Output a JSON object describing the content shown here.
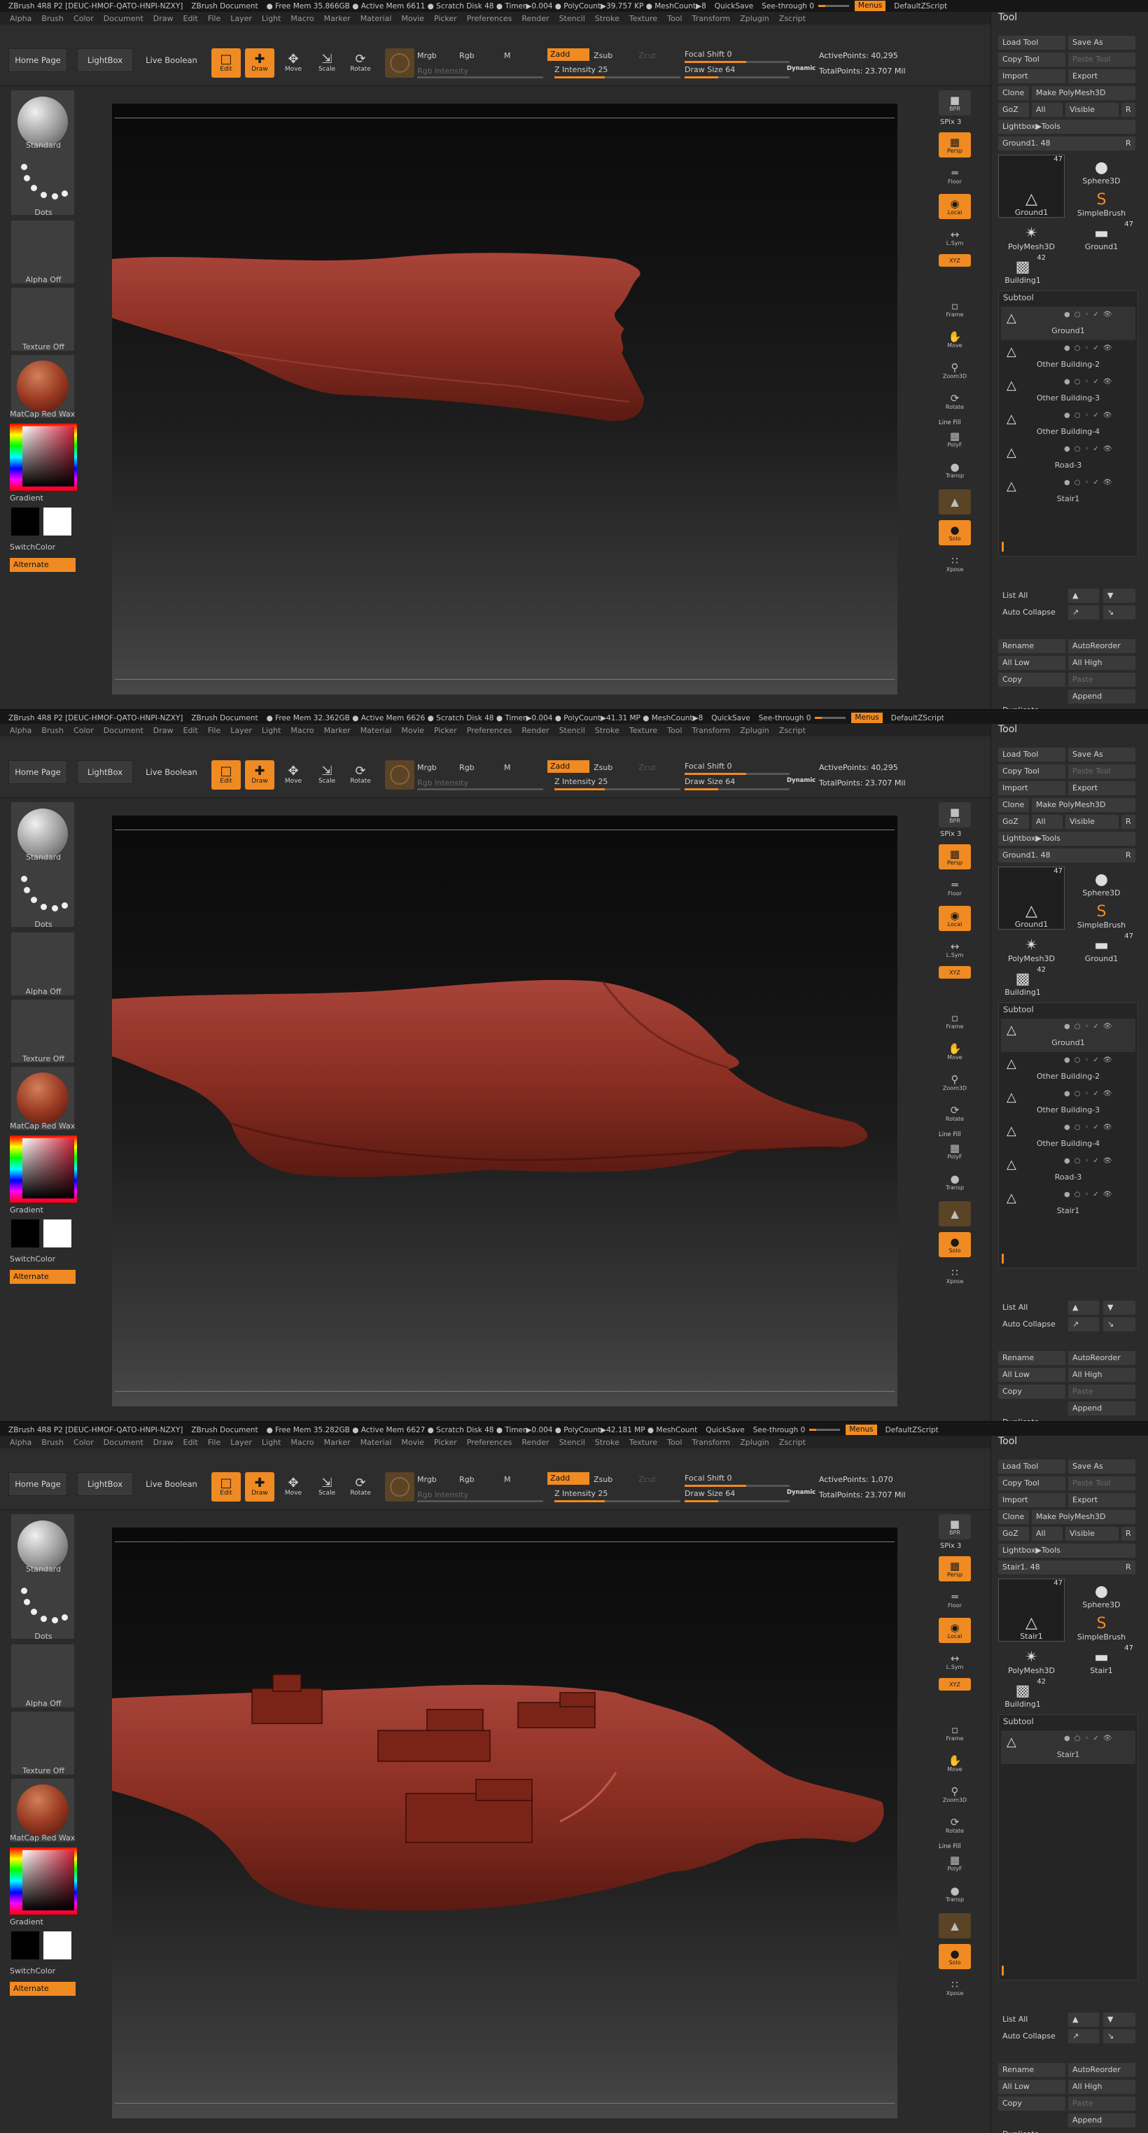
{
  "menubar": [
    "Alpha",
    "Brush",
    "Color",
    "Document",
    "Draw",
    "Edit",
    "File",
    "Layer",
    "Light",
    "Macro",
    "Marker",
    "Material",
    "Movie",
    "Picker",
    "Preferences",
    "Render",
    "Stencil",
    "Stroke",
    "Texture",
    "Tool",
    "Transform",
    "Zplugin",
    "Zscript"
  ],
  "shelf": {
    "home": "Home Page",
    "lightbox": "LightBox",
    "live_boolean": "Live Boolean",
    "edit": "Edit",
    "draw": "Draw",
    "move": "Move",
    "scale": "Scale",
    "rotate": "Rotate",
    "mrgb": "Mrgb",
    "rgb": "Rgb",
    "m": "M",
    "zadd": "Zadd",
    "zsub": "Zsub",
    "zcut": "Zcut",
    "rgb_intensity": "Rgb Intensity",
    "z_intensity": "Z Intensity 25",
    "focal_shift": "Focal Shift 0",
    "draw_size": "Draw Size 64",
    "dynamic": "Dynamic"
  },
  "left": {
    "standard": "Standard",
    "dots": "Dots",
    "alpha_off": "Alpha Off",
    "texture_off": "Texture Off",
    "matcap": "MatCap Red Wax",
    "gradient": "Gradient",
    "switchcolor": "SwitchColor",
    "alternate": "Alternate"
  },
  "right": {
    "bpr": "BPR",
    "spix": "SPix 3",
    "persp": "Persp",
    "floor": "Floor",
    "local": "Local",
    "lsym": "L.Sym",
    "xyz": "XYZ",
    "frame": "Frame",
    "move": "Move",
    "zoom3d": "Zoom3D",
    "rotate": "Rotate",
    "linefill": "Line Fill",
    "polyf": "PolyF",
    "transp": "Transp",
    "dynamic": "Dynamic",
    "solo": "Solo",
    "xpose": "Xpose"
  },
  "tool": {
    "header": "Tool",
    "load_tool": "Load Tool",
    "save_as": "Save As",
    "copy_tool": "Copy Tool",
    "paste_tool": "Paste Tool",
    "import": "Import",
    "export": "Export",
    "clone": "Clone",
    "make_polymesh": "Make PolyMesh3D",
    "goz": "GoZ",
    "all": "All",
    "visible": "Visible",
    "r": "R",
    "lightbox_tools": "Lightbox▶Tools",
    "sphere3d": "Sphere3D",
    "simplebrush": "SimpleBrush",
    "polymesh3d": "PolyMesh3D",
    "subtool": "Subtool",
    "list_all": "List All",
    "auto_collapse": "Auto Collapse",
    "rename": "Rename",
    "autoreorder": "AutoReorder",
    "all_low": "All Low",
    "all_high": "All High",
    "copy": "Copy",
    "paste": "Paste",
    "append": "Append",
    "duplicate": "Duplicate"
  },
  "panels": [
    {
      "title": [
        "ZBrush 4R8 P2 [DEUC-HMOF-QATO-HNPI-NZXY]",
        "ZBrush Document",
        "● Free Mem 35.866GB ● Active Mem 6611 ● Scratch Disk 48 ● Timer▶0.004 ● PolyCount▶39.757 KP ● MeshCount▶8",
        "QuickSave",
        "See-through 0",
        "Menus",
        "DefaultZScript"
      ],
      "active_points": "ActivePoints: 40,295",
      "total_points": "TotalPoints: 23.707 Mil",
      "current_tool": "Ground1. 48",
      "tool_thumbs": [
        {
          "label": "Ground1",
          "count": "47"
        },
        {
          "label": "Ground1",
          "count": "47"
        },
        {
          "label": "Building1",
          "count": "42"
        }
      ],
      "subtools": [
        "Ground1",
        "Other Building-2",
        "Other Building-3",
        "Other Building-4",
        "Road-3",
        "Stair1"
      ]
    },
    {
      "title": [
        "ZBrush 4R8 P2 [DEUC-HMOF-QATO-HNPI-NZXY]",
        "ZBrush Document",
        "● Free Mem 32.362GB ● Active Mem 6626 ● Scratch Disk 48 ● Timer▶0.004 ● PolyCount▶41.31 MP ● MeshCount▶8",
        "QuickSave",
        "See-through 0",
        "Menus",
        "DefaultZScript"
      ],
      "active_points": "ActivePoints: 40,295",
      "total_points": "TotalPoints: 23.707 Mil",
      "current_tool": "Ground1. 48",
      "tool_thumbs": [
        {
          "label": "Ground1",
          "count": "47"
        },
        {
          "label": "Ground1",
          "count": "47"
        },
        {
          "label": "Building1",
          "count": "42"
        }
      ],
      "subtools": [
        "Ground1",
        "Other Building-2",
        "Other Building-3",
        "Other Building-4",
        "Road-3",
        "Stair1"
      ]
    },
    {
      "title": [
        "ZBrush 4R8 P2 [DEUC-HMOF-QATO-HNPI-NZXY]",
        "ZBrush Document",
        "● Free Mem 35.282GB ● Active Mem 6627 ● Scratch Disk 48 ● Timer▶0.004 ● PolyCount▶42.181 MP ● MeshCount",
        "QuickSave",
        "See-through 0",
        "Menus",
        "DefaultZScript"
      ],
      "active_points": "ActivePoints: 1,070",
      "total_points": "TotalPoints: 23.707 Mil",
      "current_tool": "Stair1. 48",
      "tool_thumbs": [
        {
          "label": "Stair1",
          "count": "47"
        },
        {
          "label": "Stair1",
          "count": "47"
        },
        {
          "label": "Building1",
          "count": "42"
        }
      ],
      "subtools": [
        "Stair1"
      ]
    }
  ],
  "colors": {
    "accent": "#f08a22",
    "clay": "#8a2a1a",
    "bg": "#2b2b2b"
  }
}
